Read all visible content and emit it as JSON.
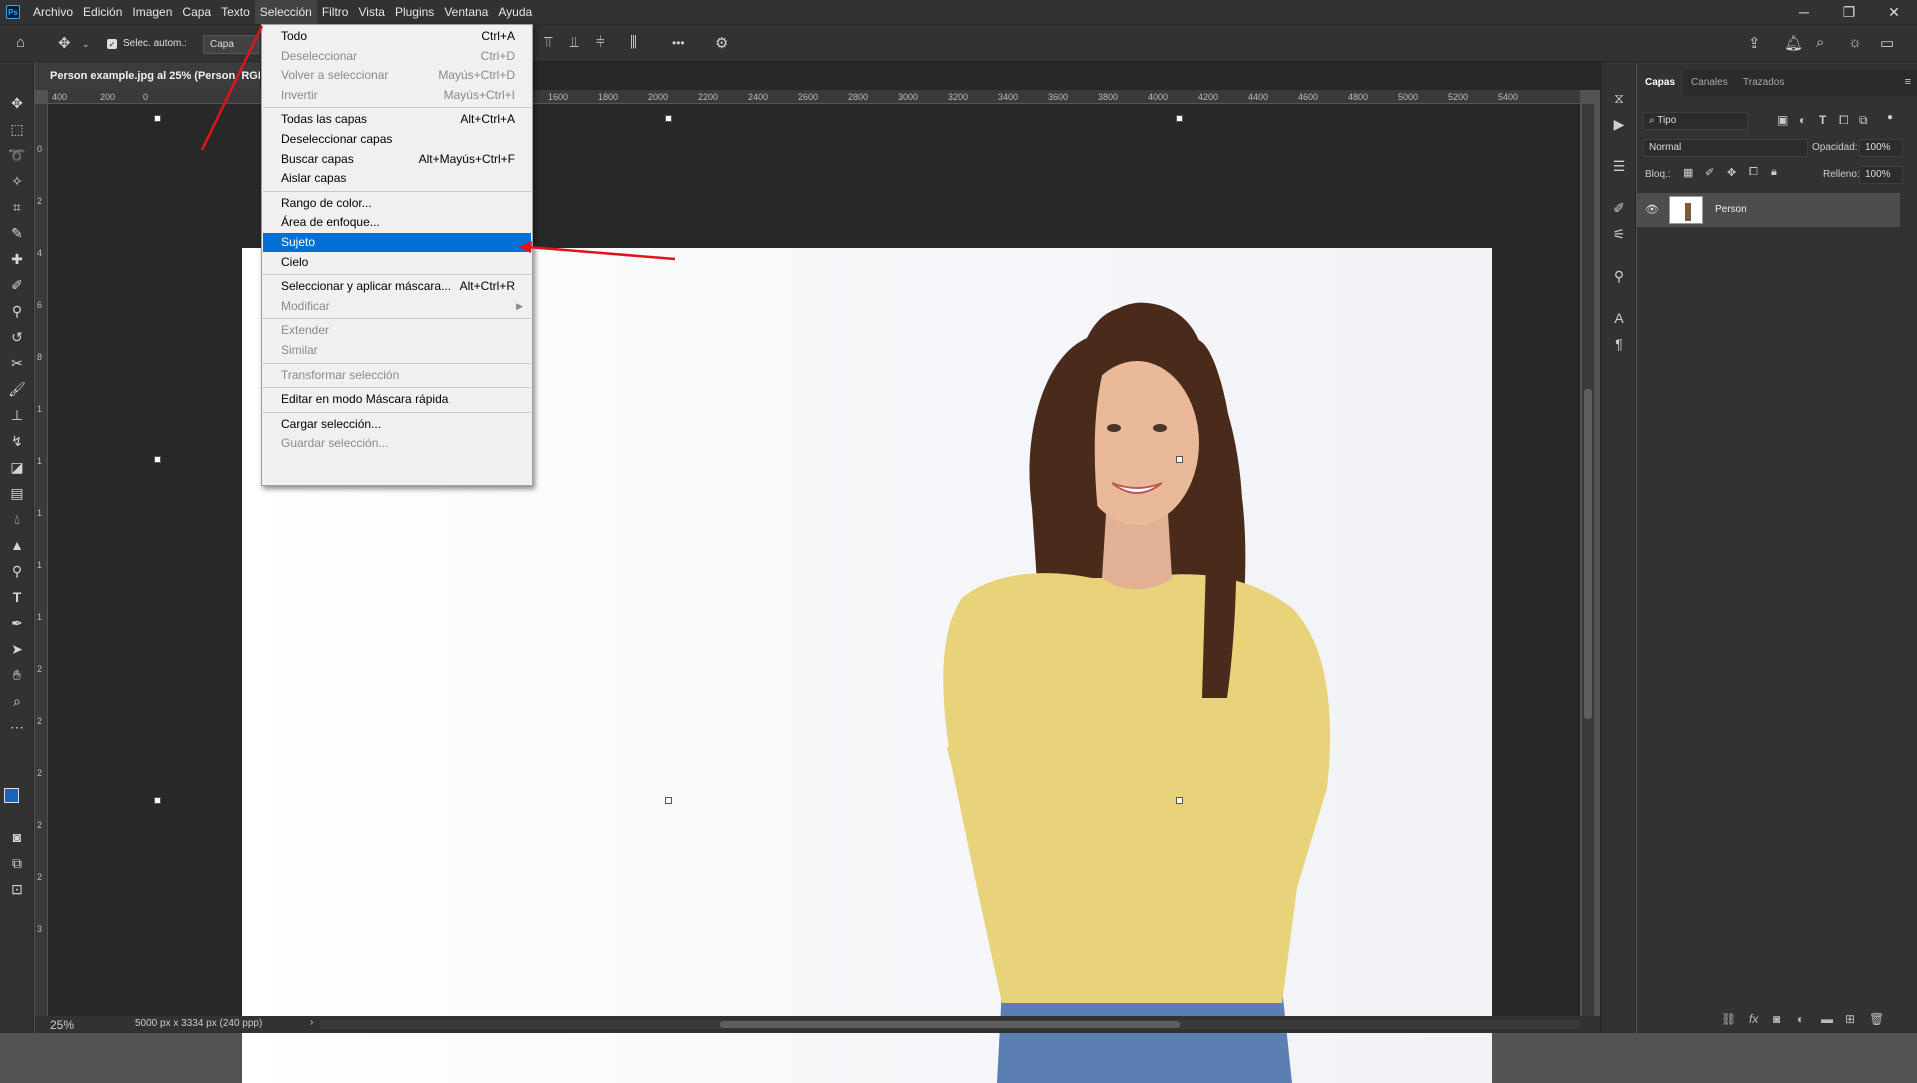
{
  "app": {
    "logo": "Ps"
  },
  "menubar": {
    "items": [
      "Archivo",
      "Edición",
      "Imagen",
      "Capa",
      "Texto",
      "Selección",
      "Filtro",
      "Vista",
      "Plugins",
      "Ventana",
      "Ayuda"
    ],
    "active": "Selección"
  },
  "window_controls": {
    "minimize": "─",
    "restore": "❐",
    "close": "✕"
  },
  "options_bar": {
    "auto_select_label": "Selec. autom.:",
    "auto_select_value": "Capa",
    "more_label": "•••"
  },
  "document": {
    "tab_title": "Person example.jpg al 25% (Person, RGB/8)",
    "zoom": "25%",
    "dimensions": "5000 px x 3334 px (240 ppp)"
  },
  "ruler": {
    "h_ticks": [
      "400",
      "200",
      "0",
      "1400",
      "1600",
      "1800",
      "2000",
      "2200",
      "2400",
      "2600",
      "2800",
      "3000",
      "3200",
      "3400",
      "3600",
      "3800",
      "4000",
      "4200",
      "4400",
      "4600",
      "4800",
      "5000",
      "5200",
      "5400"
    ],
    "v_ticks": [
      "0",
      "2",
      "4",
      "6",
      "8",
      "1",
      "1",
      "1",
      "1",
      "1",
      "2",
      "2",
      "2",
      "2",
      "2",
      "3"
    ]
  },
  "selection_menu": {
    "groups": [
      [
        {
          "label": "Todo",
          "shortcut": "Ctrl+A",
          "enabled": true
        },
        {
          "label": "Deseleccionar",
          "shortcut": "Ctrl+D",
          "enabled": false
        },
        {
          "label": "Volver a seleccionar",
          "shortcut": "Mayús+Ctrl+D",
          "enabled": false
        },
        {
          "label": "Invertir",
          "shortcut": "Mayús+Ctrl+I",
          "enabled": false
        }
      ],
      [
        {
          "label": "Todas las capas",
          "shortcut": "Alt+Ctrl+A",
          "enabled": true
        },
        {
          "label": "Deseleccionar capas",
          "shortcut": "",
          "enabled": true
        },
        {
          "label": "Buscar capas",
          "shortcut": "Alt+Mayús+Ctrl+F",
          "enabled": true
        },
        {
          "label": "Aislar capas",
          "shortcut": "",
          "enabled": true
        }
      ],
      [
        {
          "label": "Rango de color...",
          "shortcut": "",
          "enabled": true
        },
        {
          "label": "Área de enfoque...",
          "shortcut": "",
          "enabled": true
        },
        {
          "label": "Sujeto",
          "shortcut": "",
          "enabled": true,
          "highlighted": true
        },
        {
          "label": "Cielo",
          "shortcut": "",
          "enabled": true
        }
      ],
      [
        {
          "label": "Seleccionar y aplicar máscara...",
          "shortcut": "Alt+Ctrl+R",
          "enabled": true
        },
        {
          "label": "Modificar",
          "shortcut": "",
          "enabled": false,
          "submenu": true
        }
      ],
      [
        {
          "label": "Extender",
          "shortcut": "",
          "enabled": false
        },
        {
          "label": "Similar",
          "shortcut": "",
          "enabled": false
        }
      ],
      [
        {
          "label": "Transformar selección",
          "shortcut": "",
          "enabled": false
        }
      ],
      [
        {
          "label": "Editar en modo Máscara rápida",
          "shortcut": "",
          "enabled": true
        }
      ],
      [
        {
          "label": "Cargar selección...",
          "shortcut": "",
          "enabled": true
        },
        {
          "label": "Guardar selección...",
          "shortcut": "",
          "enabled": false
        }
      ]
    ],
    "submenu_arrow": "▶"
  },
  "layers_panel": {
    "tabs": [
      "Capas",
      "Canales",
      "Trazados"
    ],
    "active_tab": "Capas",
    "filter_label": "Tipo",
    "blend_mode": "Normal",
    "opacity_label": "Opacidad:",
    "opacity_value": "100%",
    "lock_label": "Bloq.:",
    "fill_label": "Relleno:",
    "fill_value": "100%",
    "layers": [
      {
        "name": "Person",
        "visible": true
      }
    ]
  },
  "colors": {
    "accent": "#0070d6",
    "annotation_arrow": "#e0141e",
    "foreground_swatch": "#1565c0",
    "background_swatch": "#2196f3",
    "sweater": "#e8d27a",
    "hair": "#4a2a1a",
    "jeans": "#5b7fb2"
  },
  "icons": {
    "toolbar": [
      "move-icon",
      "marquee-icon",
      "lasso-icon",
      "magic-wand-icon",
      "crop-icon",
      "eyedropper-icon",
      "spot-healing-icon",
      "brush-icon",
      "clone-stamp-icon",
      "history-brush-icon",
      "eraser-icon",
      "gradient-icon",
      "blur-icon",
      "dodge-icon",
      "pen-icon",
      "type-icon",
      "path-selection-icon",
      "shape-icon",
      "hand-icon",
      "zoom-icon",
      "more-tools-icon"
    ]
  }
}
